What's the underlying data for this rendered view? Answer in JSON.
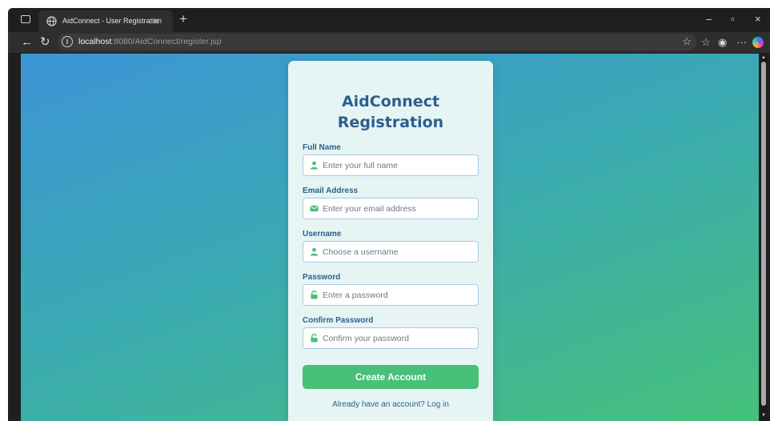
{
  "browser": {
    "tab_title": "AidConnect - User Registration",
    "tab_close": "×",
    "new_tab": "+",
    "url_host": "localhost",
    "url_rest": ":8080/AidConnect/register.jsp",
    "window_controls": {
      "minimize": "–",
      "restore": "▫",
      "close": "×"
    },
    "icons": [
      "tab-actions-icon",
      "globe-icon",
      "back-arrow-icon",
      "refresh-icon",
      "site-info-icon",
      "favorite-star-icon",
      "favorites-icon",
      "profile-icon",
      "more-icon",
      "copilot-icon"
    ]
  },
  "form": {
    "title_line1": "AidConnect",
    "title_line2": "Registration",
    "fields": [
      {
        "label": "Full Name",
        "placeholder": "Enter your full name",
        "icon": "user-icon"
      },
      {
        "label": "Email Address",
        "placeholder": "Enter your email address",
        "icon": "envelope-icon"
      },
      {
        "label": "Username",
        "placeholder": "Choose a username",
        "icon": "user-icon"
      },
      {
        "label": "Password",
        "placeholder": "Enter a password",
        "icon": "lock-icon"
      },
      {
        "label": "Confirm Password",
        "placeholder": "Confirm your password",
        "icon": "lock-icon"
      }
    ],
    "submit_label": "Create Account",
    "login_text": "Already have an account? Log in"
  },
  "colors": {
    "accent": "#48c078",
    "title": "#2b5f8e",
    "card": "#e6f4f4",
    "gradient_start": "#3c95d6",
    "gradient_end": "#45c17a"
  }
}
